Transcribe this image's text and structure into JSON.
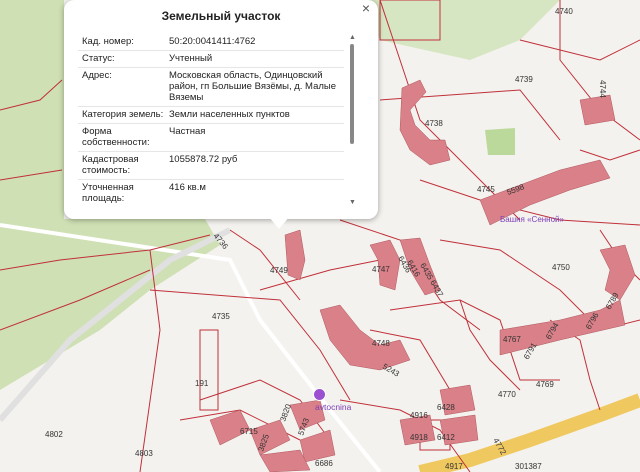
{
  "popup": {
    "title": "Земельный участок",
    "close": "×",
    "rows": [
      {
        "k": "Кад. номер:",
        "v": "50:20:0041411:4762"
      },
      {
        "k": "Статус:",
        "v": "Учтенный"
      },
      {
        "k": "Адрес:",
        "v": "Московская область, Одинцовский район, гп Большие Вязёмы, д. Малые Вяземы"
      },
      {
        "k": "Категория земель:",
        "v": "Земли населенных пунктов"
      },
      {
        "k": "Форма собственности:",
        "v": "Частная"
      },
      {
        "k": "Кадастровая стоимость:",
        "v": "1055878.72 руб"
      },
      {
        "k": "Уточненная площадь:",
        "v": "416 кв.м"
      }
    ]
  },
  "parcels": [
    "4740",
    "4744",
    "4739",
    "4738",
    "4745",
    "4750",
    "4747",
    "4749",
    "4735",
    "191",
    "4748",
    "4767",
    "4769",
    "4770",
    "4802",
    "4803",
    "4916",
    "4917",
    "4918",
    "4772",
    "301387",
    "4736",
    "5598",
    "6715",
    "6686",
    "5743",
    "3820",
    "3825",
    "6428",
    "6412",
    "6436",
    "6435",
    "6437",
    "6416",
    "5243",
    "6794",
    "6796",
    "6791",
    "6789"
  ],
  "poi": {
    "name": "avtocnina",
    "tower_label": "Башня «Сенной»"
  },
  "colors": {
    "parcel_line": "#c0303a",
    "building": "#d98088",
    "green": "#cfe0b4",
    "road": "#f0c860"
  }
}
